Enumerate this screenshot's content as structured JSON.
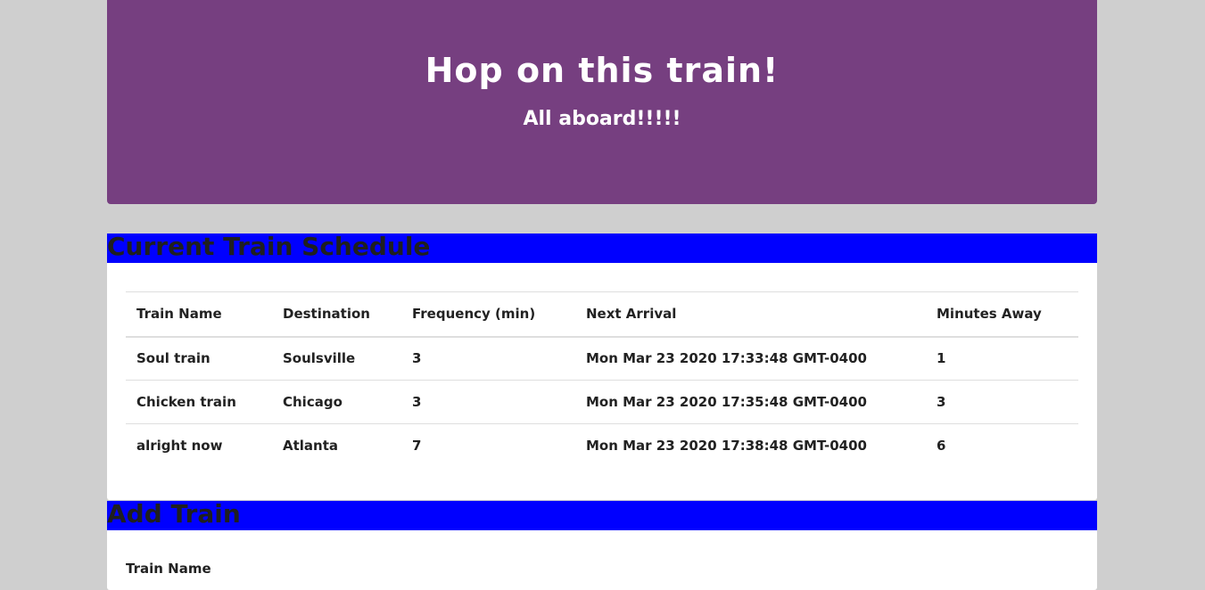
{
  "header": {
    "title": "Hop on this train!",
    "subtitle": "All aboard!!!!!"
  },
  "schedule": {
    "heading": "Current Train Schedule",
    "columns": [
      "Train Name",
      "Destination",
      "Frequency (min)",
      "Next Arrival",
      "Minutes Away"
    ],
    "rows": [
      [
        "Soul train",
        "Soulsville",
        "3",
        "Mon Mar 23 2020 17:33:48 GMT-0400",
        "1"
      ],
      [
        "Chicken train",
        "Chicago",
        "3",
        "Mon Mar 23 2020 17:35:48 GMT-0400",
        "3"
      ],
      [
        "alright now",
        "Atlanta",
        "7",
        "Mon Mar 23 2020 17:38:48 GMT-0400",
        "6"
      ]
    ]
  },
  "add_train": {
    "heading": "Add Train",
    "name_label": "Train Name"
  },
  "colors": {
    "jumbotron": "#763f80",
    "card_header": "#0000ff",
    "page_background": "#cfcfcf"
  }
}
